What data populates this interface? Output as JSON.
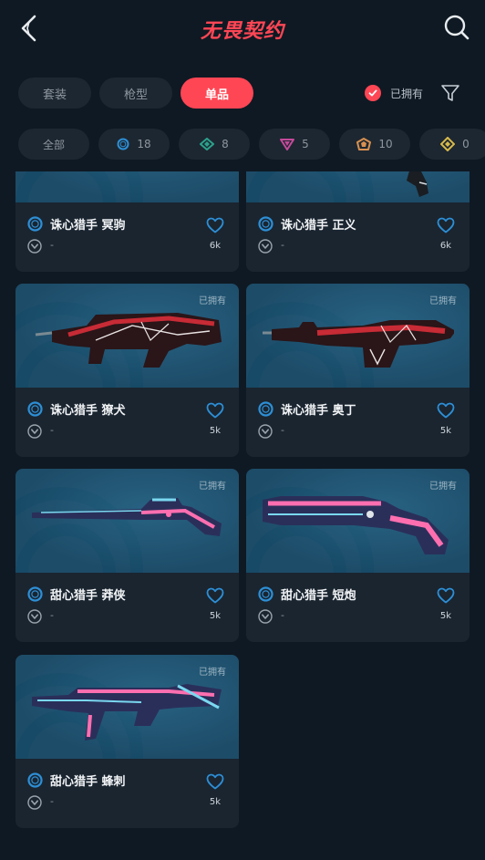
{
  "header": {
    "title": "无畏契约",
    "back_icon": "back-arrow-icon",
    "search_icon": "search-icon"
  },
  "tabs": [
    {
      "label": "套装",
      "active": false
    },
    {
      "label": "枪型",
      "active": false
    },
    {
      "label": "单品",
      "active": true
    }
  ],
  "owned_filter": {
    "label": "已拥有",
    "checked": true
  },
  "tiers": [
    {
      "label": "全部",
      "icon": ""
    },
    {
      "label": "18",
      "icon": "select-tier-icon",
      "color": "#2d8fd6"
    },
    {
      "label": "8",
      "icon": "deluxe-tier-icon",
      "color": "#2aa18c"
    },
    {
      "label": "5",
      "icon": "premium-tier-icon",
      "color": "#c64a9a"
    },
    {
      "label": "10",
      "icon": "exclusive-tier-icon",
      "color": "#d99050"
    },
    {
      "label": "0",
      "icon": "ultra-tier-icon",
      "color": "#d7b94a"
    }
  ],
  "skins": [
    {
      "name": "诛心猎手 冥驹",
      "likes": "6k",
      "rarity": "-",
      "owned_label": ""
    },
    {
      "name": "诛心猎手 正义",
      "likes": "6k",
      "rarity": "-",
      "owned_label": ""
    },
    {
      "name": "诛心猎手 獠犬",
      "likes": "5k",
      "rarity": "-",
      "owned_label": "已拥有"
    },
    {
      "name": "诛心猎手 奥丁",
      "likes": "5k",
      "rarity": "-",
      "owned_label": "已拥有"
    },
    {
      "name": "甜心猎手 莽侠",
      "likes": "5k",
      "rarity": "-",
      "owned_label": "已拥有"
    },
    {
      "name": "甜心猎手 短炮",
      "likes": "5k",
      "rarity": "-",
      "owned_label": "已拥有"
    },
    {
      "name": "甜心猎手 蜂刺",
      "likes": "5k",
      "rarity": "-",
      "owned_label": "已拥有"
    }
  ],
  "colors": {
    "accent": "#ff4655",
    "background": "#0f1923",
    "card": "#1a2530",
    "select_tier": "#2d8fd6"
  }
}
